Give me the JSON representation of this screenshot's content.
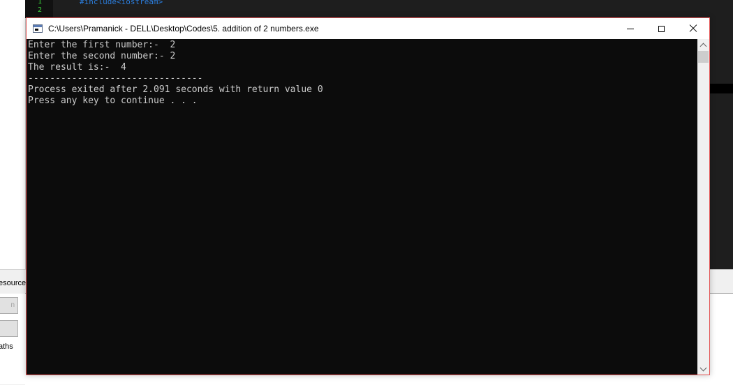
{
  "ide": {
    "line_numbers": [
      "1",
      "2"
    ],
    "code_line": "#include<iostream>",
    "bottom_tab_label": "esources",
    "paths_label": "aths"
  },
  "console": {
    "title": "C:\\Users\\Pramanick - DELL\\Desktop\\Codes\\5. addition of 2 numbers.exe",
    "output": "Enter the first number:-  2\nEnter the second number:- 2\nThe result is:-  4\n--------------------------------\nProcess exited after 2.091 seconds with return value 0\nPress any key to continue . . .",
    "border_color": "#e35656",
    "background_color": "#0c0c0c",
    "text_color": "#cccccc"
  },
  "window_controls": {
    "minimize_icon": "minimize-icon",
    "maximize_icon": "maximize-icon",
    "close_icon": "close-icon"
  }
}
